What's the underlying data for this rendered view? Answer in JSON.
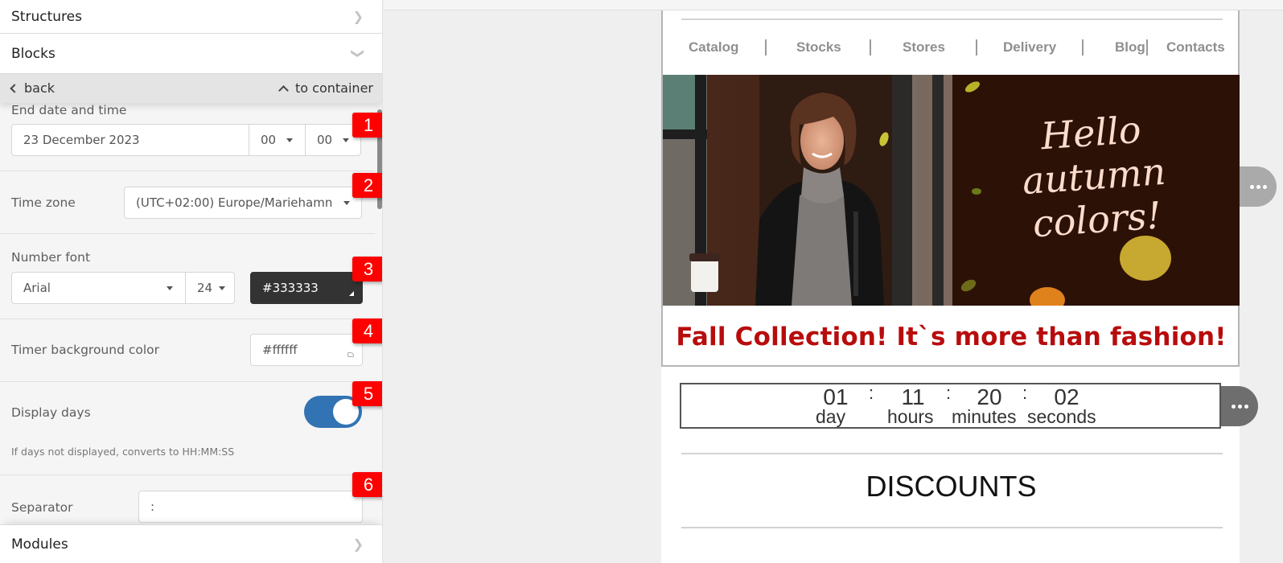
{
  "sidebar": {
    "structures_label": "Structures",
    "blocks_label": "Blocks",
    "modules_label": "Modules",
    "nav": {
      "back_label": "back",
      "to_container_label": "to container"
    },
    "end_date": {
      "label": "End date and time",
      "date_value": "23 December 2023",
      "hour_value": "00",
      "minute_value": "00"
    },
    "time_zone": {
      "label": "Time zone",
      "value": "(UTC+02:00) Europe/Mariehamn"
    },
    "number_font": {
      "label": "Number font",
      "font_value": "Arial",
      "size_value": "24",
      "color_value": "#333333"
    },
    "timer_bg": {
      "label": "Timer background color",
      "value": "#ffffff"
    },
    "display_days": {
      "label": "Display days",
      "enabled": true,
      "hint": "If days not displayed, converts to HH:MM:SS"
    },
    "separator": {
      "label": "Separator",
      "value": ":"
    },
    "badges": [
      "1",
      "2",
      "3",
      "4",
      "5",
      "6"
    ]
  },
  "email": {
    "menu": [
      "Catalog",
      "Stocks",
      "Stores",
      "Delivery",
      "Blog",
      "Contacts"
    ],
    "hero_text": [
      "Hello",
      "autumn",
      "colors!"
    ],
    "headline": "Fall Collection! It`s more than fashion!",
    "timer": {
      "separator": ":",
      "units": [
        {
          "value": "01",
          "label": "day"
        },
        {
          "value": "11",
          "label": "hours"
        },
        {
          "value": "20",
          "label": "minutes"
        },
        {
          "value": "02",
          "label": "seconds"
        }
      ]
    },
    "discounts_title": "DISCOUNTS"
  },
  "colors": {
    "badge": "#ff0000",
    "toggle_on": "#3273b3",
    "headline": "#b80c0c",
    "number_color_swatch": "#333333"
  }
}
